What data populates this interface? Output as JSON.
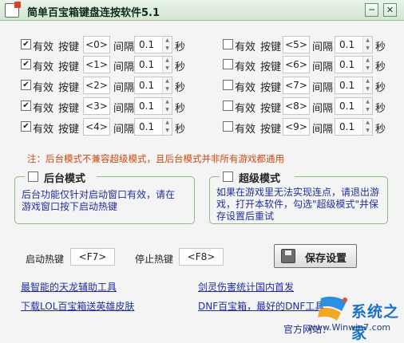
{
  "window": {
    "title": "简单百宝箱键盘连按软件5.1",
    "minimize_label": "─",
    "close_label": "✕"
  },
  "labels": {
    "enabled": "有效",
    "key": "按键",
    "interval": "间隔",
    "seconds": "秒"
  },
  "key_rows": [
    {
      "enabled": true,
      "key": "<0>",
      "interval": "0.1"
    },
    {
      "enabled": true,
      "key": "<1>",
      "interval": "0.1"
    },
    {
      "enabled": true,
      "key": "<2>",
      "interval": "0.1"
    },
    {
      "enabled": true,
      "key": "<3>",
      "interval": "0.1"
    },
    {
      "enabled": true,
      "key": "<4>",
      "interval": "0.1"
    },
    {
      "enabled": false,
      "key": "<5>",
      "interval": "0.1"
    },
    {
      "enabled": false,
      "key": "<6>",
      "interval": "0.1"
    },
    {
      "enabled": false,
      "key": "<7>",
      "interval": "0.1"
    },
    {
      "enabled": false,
      "key": "<8>",
      "interval": "0.1"
    },
    {
      "enabled": false,
      "key": "<9>",
      "interval": "0.1"
    }
  ],
  "note": "注：后台模式不兼容超级模式，且后台模式并非所有游戏都通用",
  "background_mode": {
    "title": "后台模式",
    "checked": false,
    "description_line1": "后台功能仅针对启动窗口有效，请在",
    "description_line2": "游戏窗口按下启动热键"
  },
  "super_mode": {
    "title": "超级模式",
    "checked": false,
    "description_line1": "如果在游戏里无法实现连点，请退出游",
    "description_line2": "戏，打开本软件，勾选\"超级模式\"并保",
    "description_line3": "存设置后重试"
  },
  "hotkeys": {
    "start_label": "启动热键",
    "start_value": "<F7>",
    "stop_label": "停止热键",
    "stop_value": "<F8>",
    "save_label": "保存设置"
  },
  "links": {
    "link1": "最智能的天龙辅助工具",
    "link2": "剑灵伤害统计国内首发",
    "link3": "下载LOL百宝箱送英雄皮肤",
    "link4": "DNF百宝箱，最好的DNF工具"
  },
  "footer": {
    "official_site": "官方网站："
  },
  "watermark": {
    "brand": "系统之家",
    "site": "www.Winwin7.com"
  },
  "colors": {
    "note": "#d04810",
    "link": "#1f2f9f",
    "group_border": "#8ebe86"
  }
}
